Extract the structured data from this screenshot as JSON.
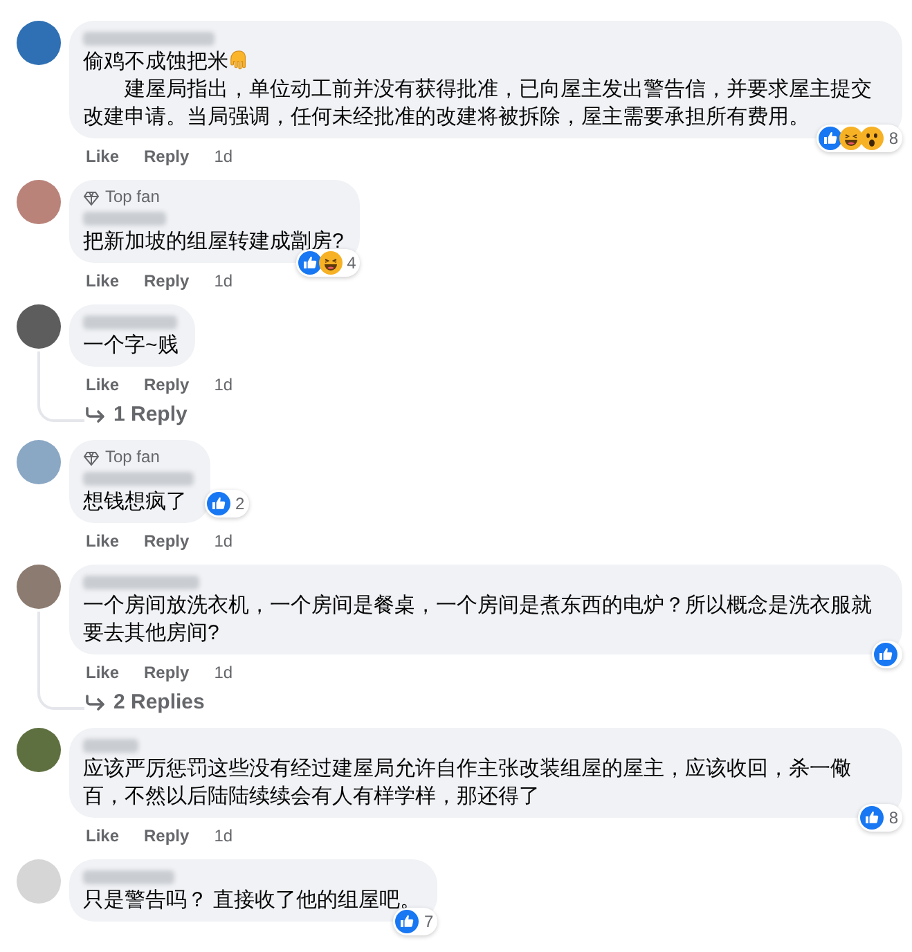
{
  "comments": [
    {
      "lines": [
        {
          "kind": "hand",
          "text": "偷鸡不成蚀把米"
        },
        {
          "kind": "indented",
          "text": "建屋局指出，单位动工前并没有获得批准，已向屋主发出警告信，并要求屋主提交改建申请。当局强调，任何未经批准的改建将被拆除，屋主需要承担所有费用。"
        }
      ],
      "reactions": {
        "like": true,
        "haha": true,
        "wow": true,
        "count": "8",
        "inline": false
      },
      "actions": {
        "like": "Like",
        "reply": "Reply",
        "time": "1d"
      }
    },
    {
      "badge": "Top fan",
      "lines": [
        {
          "kind": "plain",
          "text": "把新加坡的组屋转建成劏房?"
        }
      ],
      "reactions": {
        "like": true,
        "haha": true,
        "wow": false,
        "count": "4",
        "inline": false
      },
      "actions": {
        "like": "Like",
        "reply": "Reply",
        "time": "1d"
      }
    },
    {
      "lines": [
        {
          "kind": "plain",
          "text": "一个字~贱"
        }
      ],
      "actions": {
        "like": "Like",
        "reply": "Reply",
        "time": "1d"
      },
      "replies_link": "1 Reply"
    },
    {
      "badge": "Top fan",
      "lines": [
        {
          "kind": "plain",
          "text": "想钱想疯了"
        }
      ],
      "reactions": {
        "like": true,
        "haha": false,
        "wow": false,
        "count": "2",
        "inline": true
      },
      "actions": {
        "like": "Like",
        "reply": "Reply",
        "time": "1d"
      }
    },
    {
      "lines": [
        {
          "kind": "plain",
          "text": "一个房间放洗衣机，一个房间是餐桌，一个房间是煮东西的电炉？所以概念是洗衣服就要去其他房间?"
        }
      ],
      "reactions": {
        "like": true,
        "haha": false,
        "wow": false,
        "inline": false
      },
      "actions": {
        "like": "Like",
        "reply": "Reply",
        "time": "1d"
      },
      "replies_link": "2 Replies"
    },
    {
      "lines": [
        {
          "kind": "plain",
          "text": "应该严厉惩罚这些没有经过建屋局允许自作主张改装组屋的屋主，应该收回，杀一儆百，不然以后陆陆续续会有人有样学样，那还得了"
        }
      ],
      "reactions": {
        "like": true,
        "haha": false,
        "wow": false,
        "count": "8",
        "inline": false
      },
      "actions": {
        "like": "Like",
        "reply": "Reply",
        "time": "1d"
      }
    },
    {
      "lines": [
        {
          "kind": "plain",
          "text": "只是警告吗？ 直接收了他的组屋吧。"
        }
      ],
      "reactions": {
        "like": true,
        "haha": false,
        "wow": false,
        "count": "7",
        "inline": false
      }
    }
  ]
}
